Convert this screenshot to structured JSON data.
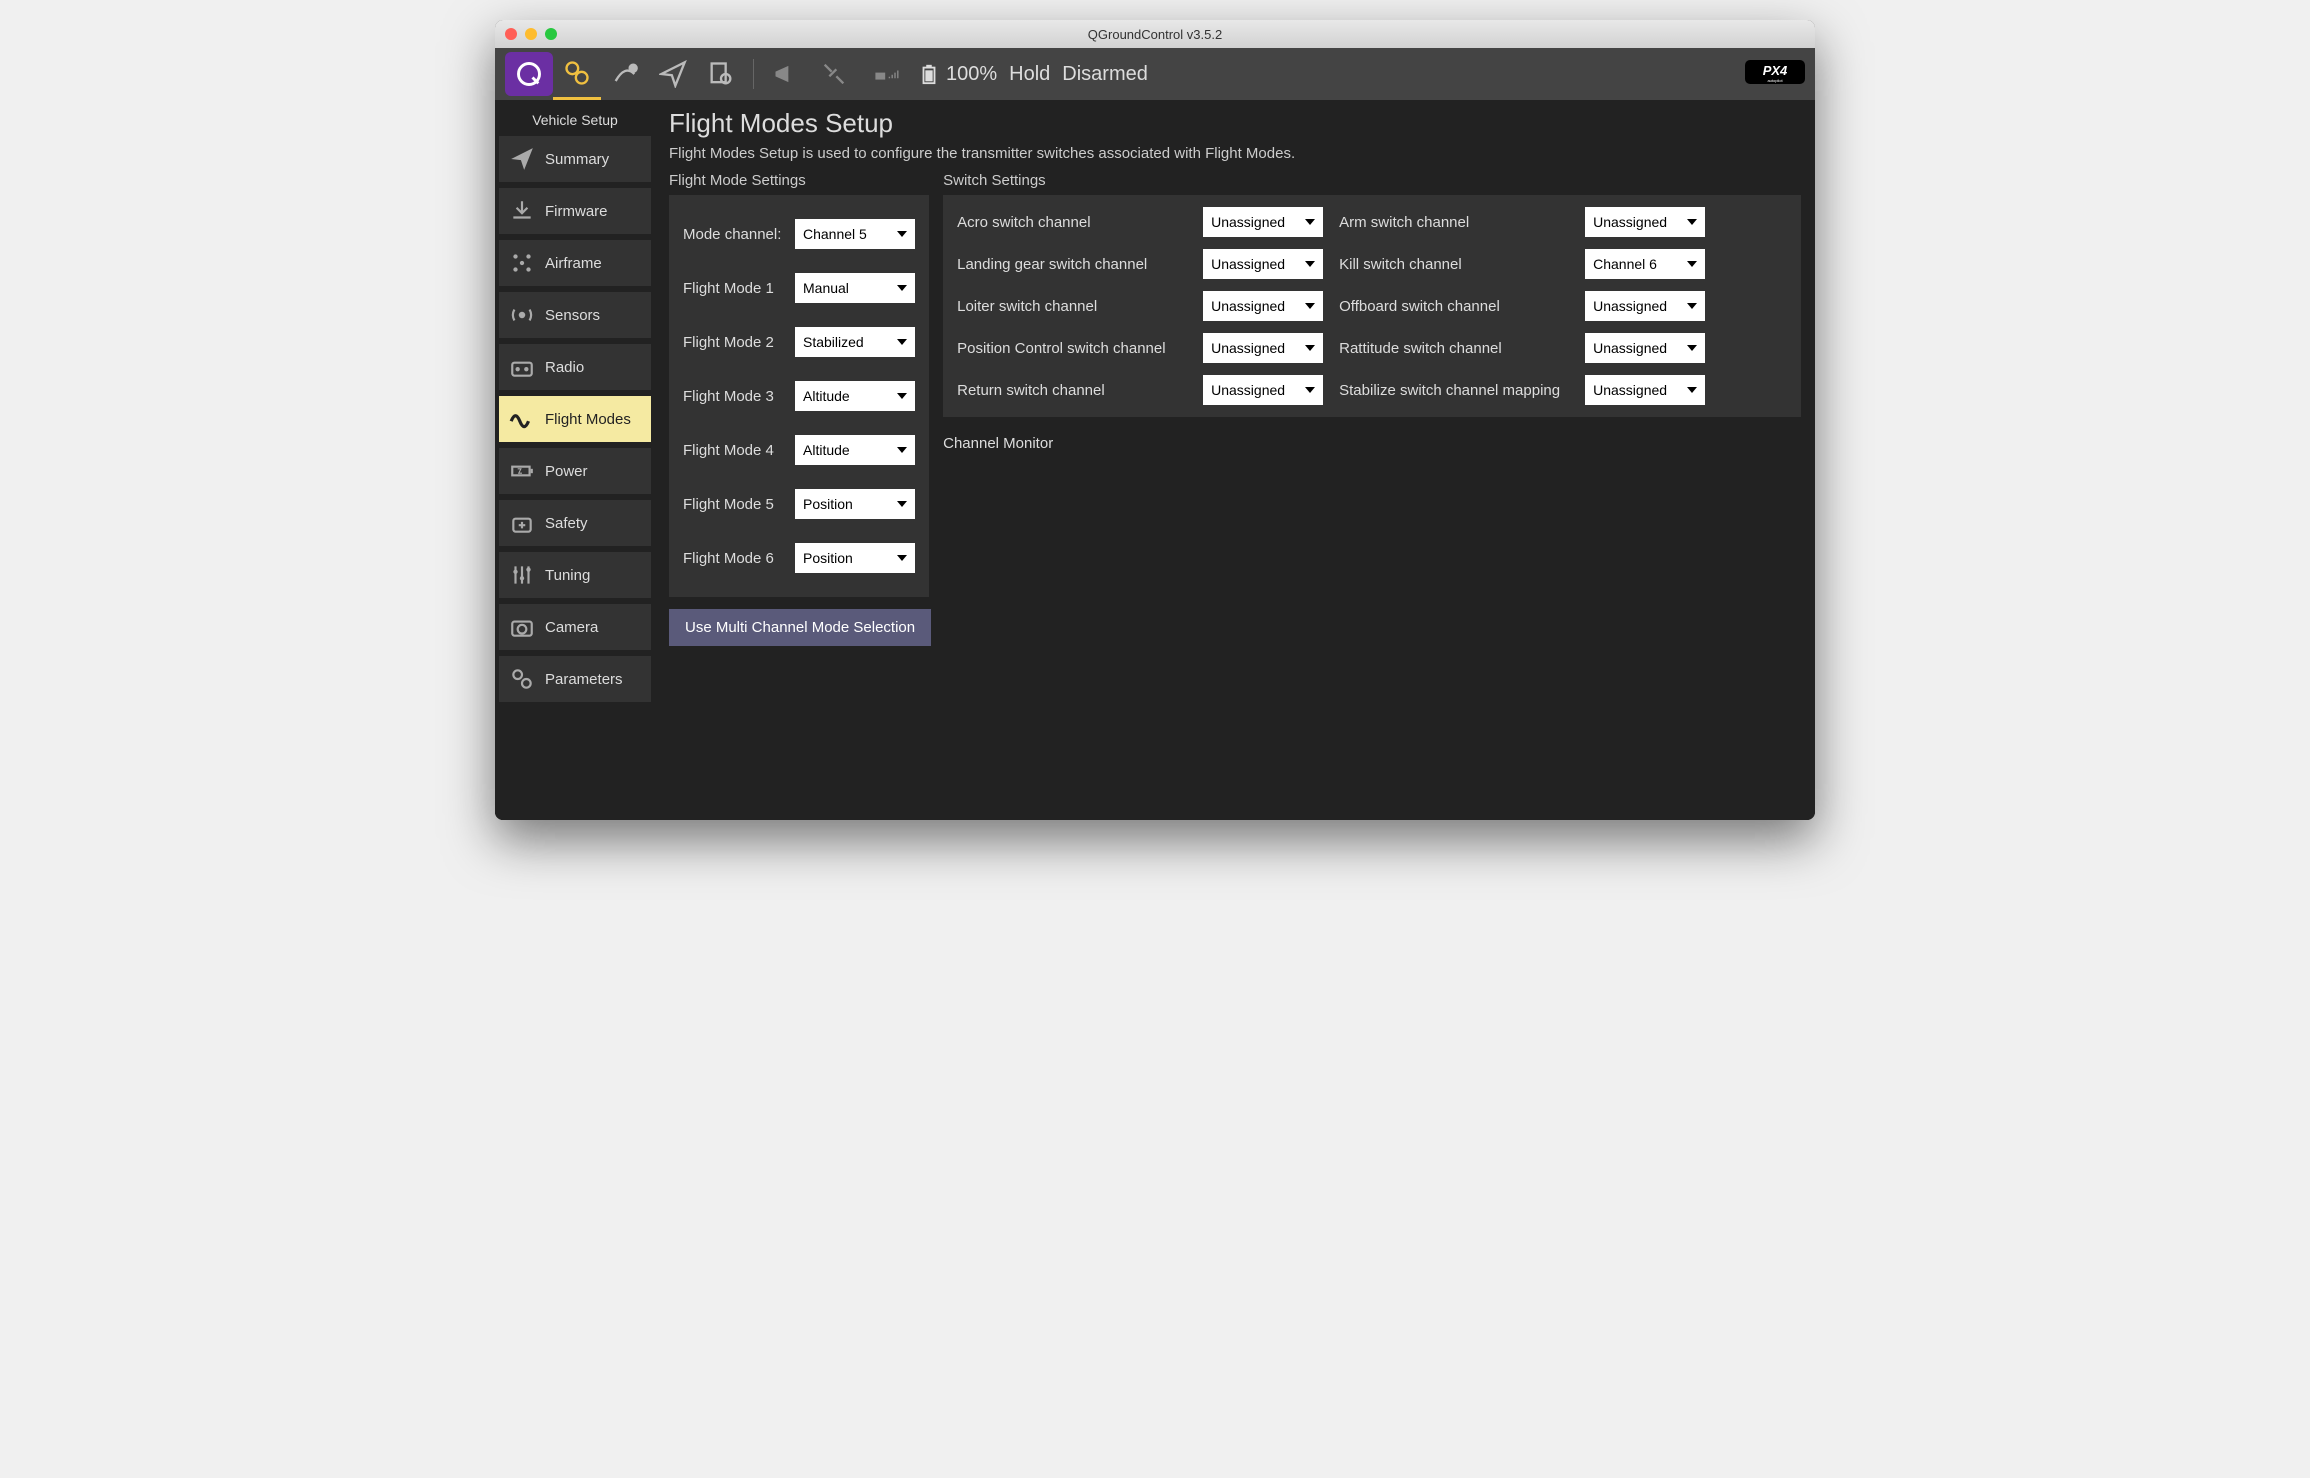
{
  "window": {
    "title": "QGroundControl v3.5.2"
  },
  "toolbar": {
    "battery": "100%",
    "flight_mode": "Hold",
    "arm_state": "Disarmed"
  },
  "sidebar": {
    "title": "Vehicle Setup",
    "items": [
      "Summary",
      "Firmware",
      "Airframe",
      "Sensors",
      "Radio",
      "Flight Modes",
      "Power",
      "Safety",
      "Tuning",
      "Camera",
      "Parameters"
    ],
    "active_index": 5
  },
  "main": {
    "title": "Flight Modes Setup",
    "description": "Flight Modes Setup is used to configure the transmitter switches associated with Flight Modes.",
    "flight_mode_settings": {
      "title": "Flight Mode Settings",
      "mode_channel_label": "Mode channel:",
      "mode_channel_value": "Channel 5",
      "modes": [
        {
          "label": "Flight Mode 1",
          "value": "Manual"
        },
        {
          "label": "Flight Mode 2",
          "value": "Stabilized"
        },
        {
          "label": "Flight Mode 3",
          "value": "Altitude"
        },
        {
          "label": "Flight Mode 4",
          "value": "Altitude"
        },
        {
          "label": "Flight Mode 5",
          "value": "Position"
        },
        {
          "label": "Flight Mode 6",
          "value": "Position"
        }
      ]
    },
    "switch_settings": {
      "title": "Switch Settings",
      "rows": [
        {
          "l": "Acro switch channel",
          "lv": "Unassigned",
          "r": "Arm switch channel",
          "rv": "Unassigned"
        },
        {
          "l": "Landing gear switch channel",
          "lv": "Unassigned",
          "r": "Kill switch channel",
          "rv": "Channel 6"
        },
        {
          "l": "Loiter switch channel",
          "lv": "Unassigned",
          "r": "Offboard switch channel",
          "rv": "Unassigned"
        },
        {
          "l": "Position Control switch channel",
          "lv": "Unassigned",
          "r": "Rattitude switch channel",
          "rv": "Unassigned"
        },
        {
          "l": "Return switch channel",
          "lv": "Unassigned",
          "r": "Stabilize switch channel mapping",
          "rv": "Unassigned"
        }
      ]
    },
    "channel_monitor": "Channel Monitor",
    "multi_button": "Use Multi Channel Mode Selection"
  }
}
